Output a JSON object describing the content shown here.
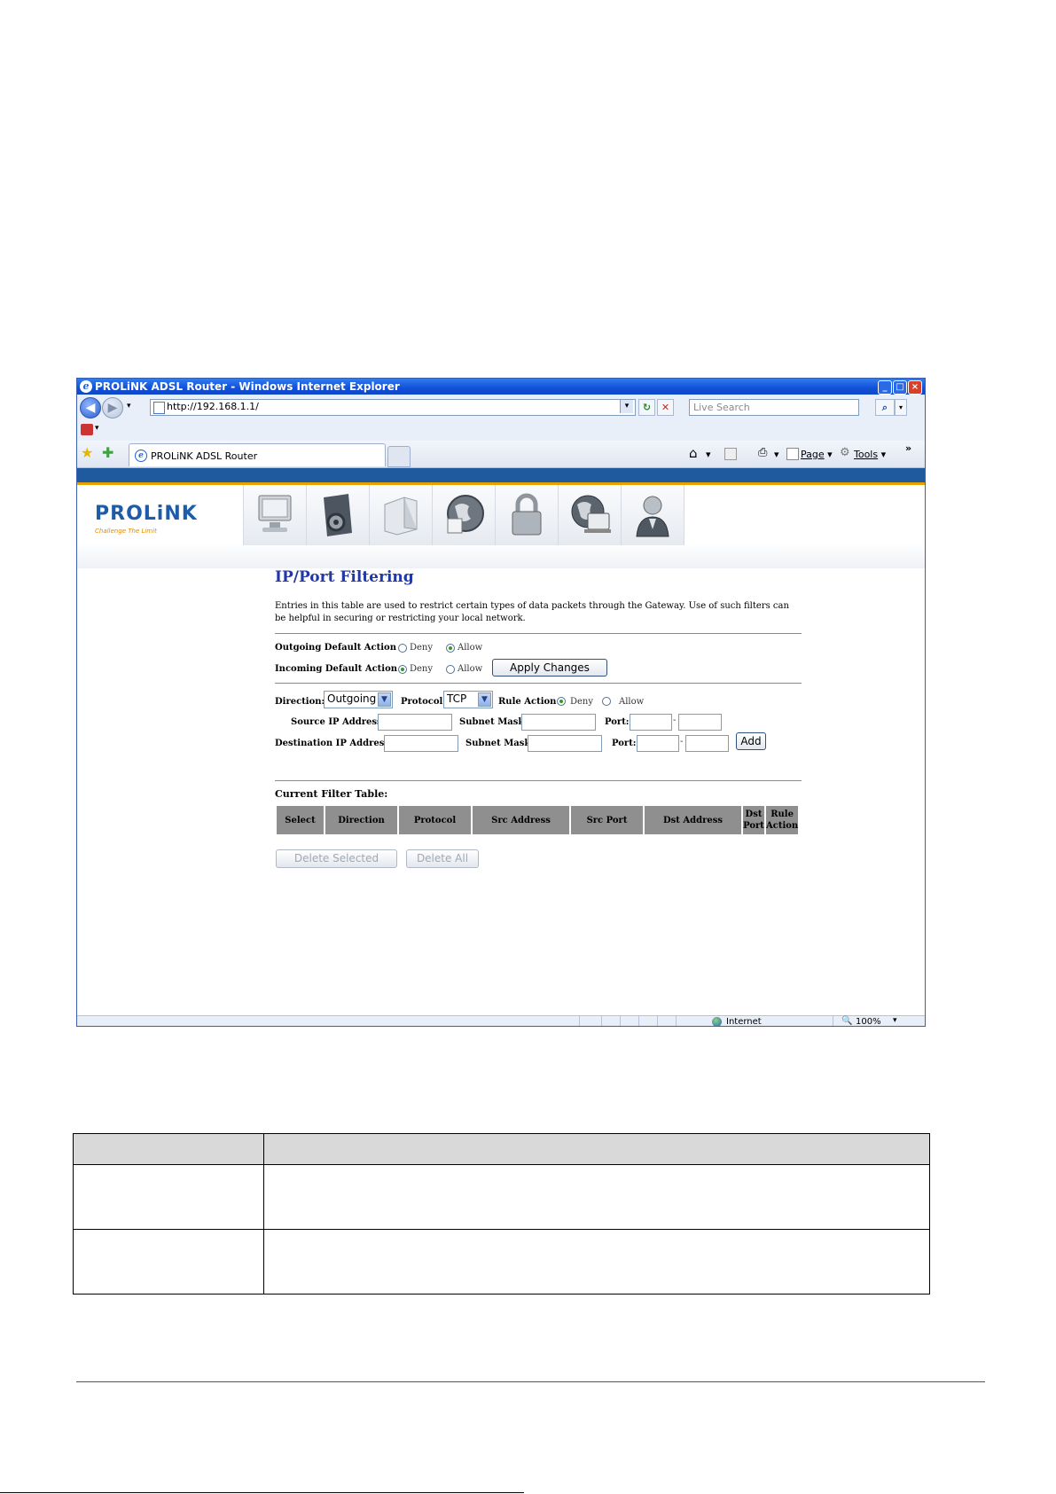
{
  "browser": {
    "title": "PROLiNK ADSL Router - Windows Internet Explorer",
    "address": "http://192.168.1.1/",
    "search_placeholder": "Live Search",
    "tab_label": "PROLiNK ADSL Router",
    "commands": {
      "page": "Page",
      "tools": "Tools"
    },
    "status": {
      "zone": "Internet",
      "zoom": "100%"
    }
  },
  "router": {
    "logo": "PROLiNK",
    "tagline": "Challenge The Limit",
    "nav_icons": [
      "status-icon",
      "setup-icon",
      "advanced-icon",
      "network-icon",
      "security-icon",
      "internet-icon",
      "admin-icon"
    ],
    "page_title": "IP/Port Filtering",
    "description": "Entries in this table are used to restrict certain types of data packets through the Gateway. Use of such filters can be helpful in securing or restricting your local network.",
    "outgoing_default": {
      "label": "Outgoing Default Action",
      "options": [
        "Deny",
        "Allow"
      ],
      "selected": "Allow"
    },
    "incoming_default": {
      "label": "Incoming Default Action",
      "options": [
        "Deny",
        "Allow"
      ],
      "selected": "Deny"
    },
    "apply_button": "Apply Changes",
    "direction": {
      "label": "Direction:",
      "value": "Outgoing"
    },
    "protocol": {
      "label": "Protocol:",
      "value": "TCP"
    },
    "rule_action": {
      "label": "Rule Action",
      "options": [
        "Deny",
        "Allow"
      ],
      "selected": "Deny"
    },
    "source": {
      "ip_label": "Source IP Address:",
      "mask_label": "Subnet Mask:",
      "port_label": "Port:"
    },
    "destination": {
      "ip_label": "Destination IP Address:",
      "mask_label": "Subnet Mask:",
      "port_label": "Port:"
    },
    "add_button": "Add",
    "port_separator": "-",
    "table_title": "Current Filter Table:",
    "table_headers": [
      "Select",
      "Direction",
      "Protocol",
      "Src Address",
      "Src Port",
      "Dst Address",
      "Dst Port",
      "Rule Action"
    ],
    "delete_selected": "Delete Selected",
    "delete_all": "Delete All"
  },
  "colors": {
    "title_blue": "#2237a8",
    "stripe": "#1f5a9e",
    "accent_orange": "#e8a100",
    "table_header": "#8f8f8f"
  }
}
